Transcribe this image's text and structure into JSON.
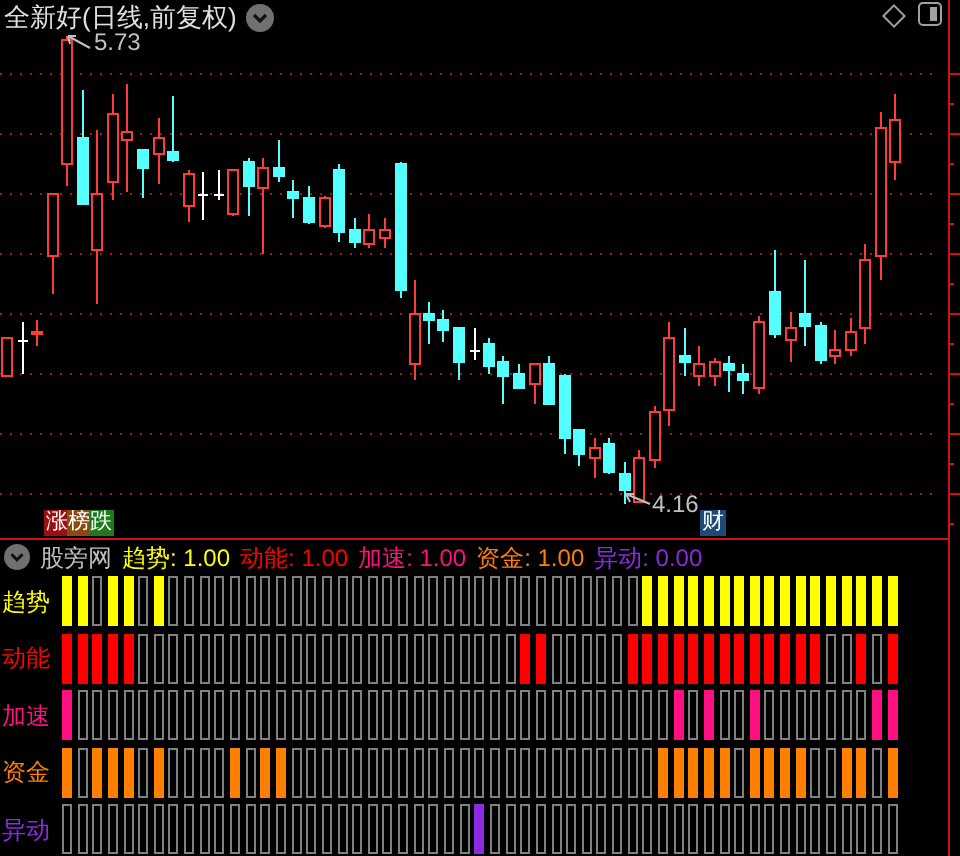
{
  "chart": {
    "title": "全新好(日线,前复权)",
    "high_label": "5.73",
    "low_label": "4.16",
    "rank_badge": "涨榜跌",
    "finance_badge": "财"
  },
  "indicator": {
    "name": "股旁网",
    "legend": [
      {
        "label": "趋势: 1.00",
        "color": "#ffff00"
      },
      {
        "label": "动能: 1.00",
        "color": "#ff0000"
      },
      {
        "label": "加速: 1.00",
        "color": "#ff1080"
      },
      {
        "label": "资金: 1.00",
        "color": "#ff8000"
      },
      {
        "label": "异动: 0.00",
        "color": "#8a2be2"
      }
    ],
    "rows": [
      {
        "label": "趋势",
        "color": "#ffff00",
        "cells": [
          true,
          true,
          false,
          true,
          true,
          false,
          true,
          false,
          false,
          false,
          false,
          false,
          false,
          false,
          false,
          false,
          false,
          false,
          false,
          false,
          false,
          false,
          false,
          false,
          false,
          false,
          false,
          false,
          false,
          false,
          false,
          false,
          false,
          false,
          false,
          false,
          false,
          false,
          true,
          true,
          true,
          true,
          true,
          true,
          true,
          true,
          true,
          true,
          true,
          true,
          true,
          true,
          true,
          true,
          true
        ]
      },
      {
        "label": "动能",
        "color": "#ff0000",
        "cells": [
          true,
          true,
          true,
          true,
          true,
          false,
          false,
          false,
          false,
          false,
          false,
          false,
          false,
          false,
          false,
          false,
          false,
          false,
          false,
          false,
          false,
          false,
          false,
          false,
          false,
          false,
          false,
          false,
          false,
          false,
          true,
          true,
          false,
          false,
          false,
          false,
          false,
          true,
          true,
          true,
          true,
          true,
          true,
          true,
          true,
          true,
          true,
          true,
          true,
          true,
          false,
          false,
          true,
          false,
          true
        ]
      },
      {
        "label": "加速",
        "color": "#ff1080",
        "cells": [
          true,
          false,
          false,
          false,
          false,
          false,
          false,
          false,
          false,
          false,
          false,
          false,
          false,
          false,
          false,
          false,
          false,
          false,
          false,
          false,
          false,
          false,
          false,
          false,
          false,
          false,
          false,
          false,
          false,
          false,
          false,
          false,
          false,
          false,
          false,
          false,
          false,
          false,
          false,
          false,
          true,
          false,
          true,
          false,
          false,
          true,
          false,
          false,
          false,
          false,
          false,
          false,
          false,
          true,
          true
        ]
      },
      {
        "label": "资金",
        "color": "#ff8000",
        "cells": [
          true,
          false,
          true,
          true,
          true,
          false,
          true,
          false,
          false,
          false,
          false,
          true,
          false,
          true,
          true,
          false,
          false,
          false,
          false,
          false,
          false,
          false,
          false,
          false,
          false,
          false,
          false,
          false,
          false,
          false,
          false,
          false,
          false,
          false,
          false,
          false,
          false,
          false,
          false,
          true,
          true,
          true,
          true,
          true,
          false,
          true,
          true,
          true,
          true,
          false,
          false,
          true,
          true,
          false,
          true
        ]
      },
      {
        "label": "异动",
        "color": "#8a2be2",
        "cells": [
          false,
          false,
          false,
          false,
          false,
          false,
          false,
          false,
          false,
          false,
          false,
          false,
          false,
          false,
          false,
          false,
          false,
          false,
          false,
          false,
          false,
          false,
          false,
          false,
          false,
          false,
          false,
          true,
          false,
          false,
          false,
          false,
          false,
          false,
          false,
          false,
          false,
          false,
          false,
          false,
          false,
          false,
          false,
          false,
          false,
          false,
          false,
          false,
          false,
          false,
          false,
          false,
          false,
          false,
          false
        ]
      }
    ]
  }
}
